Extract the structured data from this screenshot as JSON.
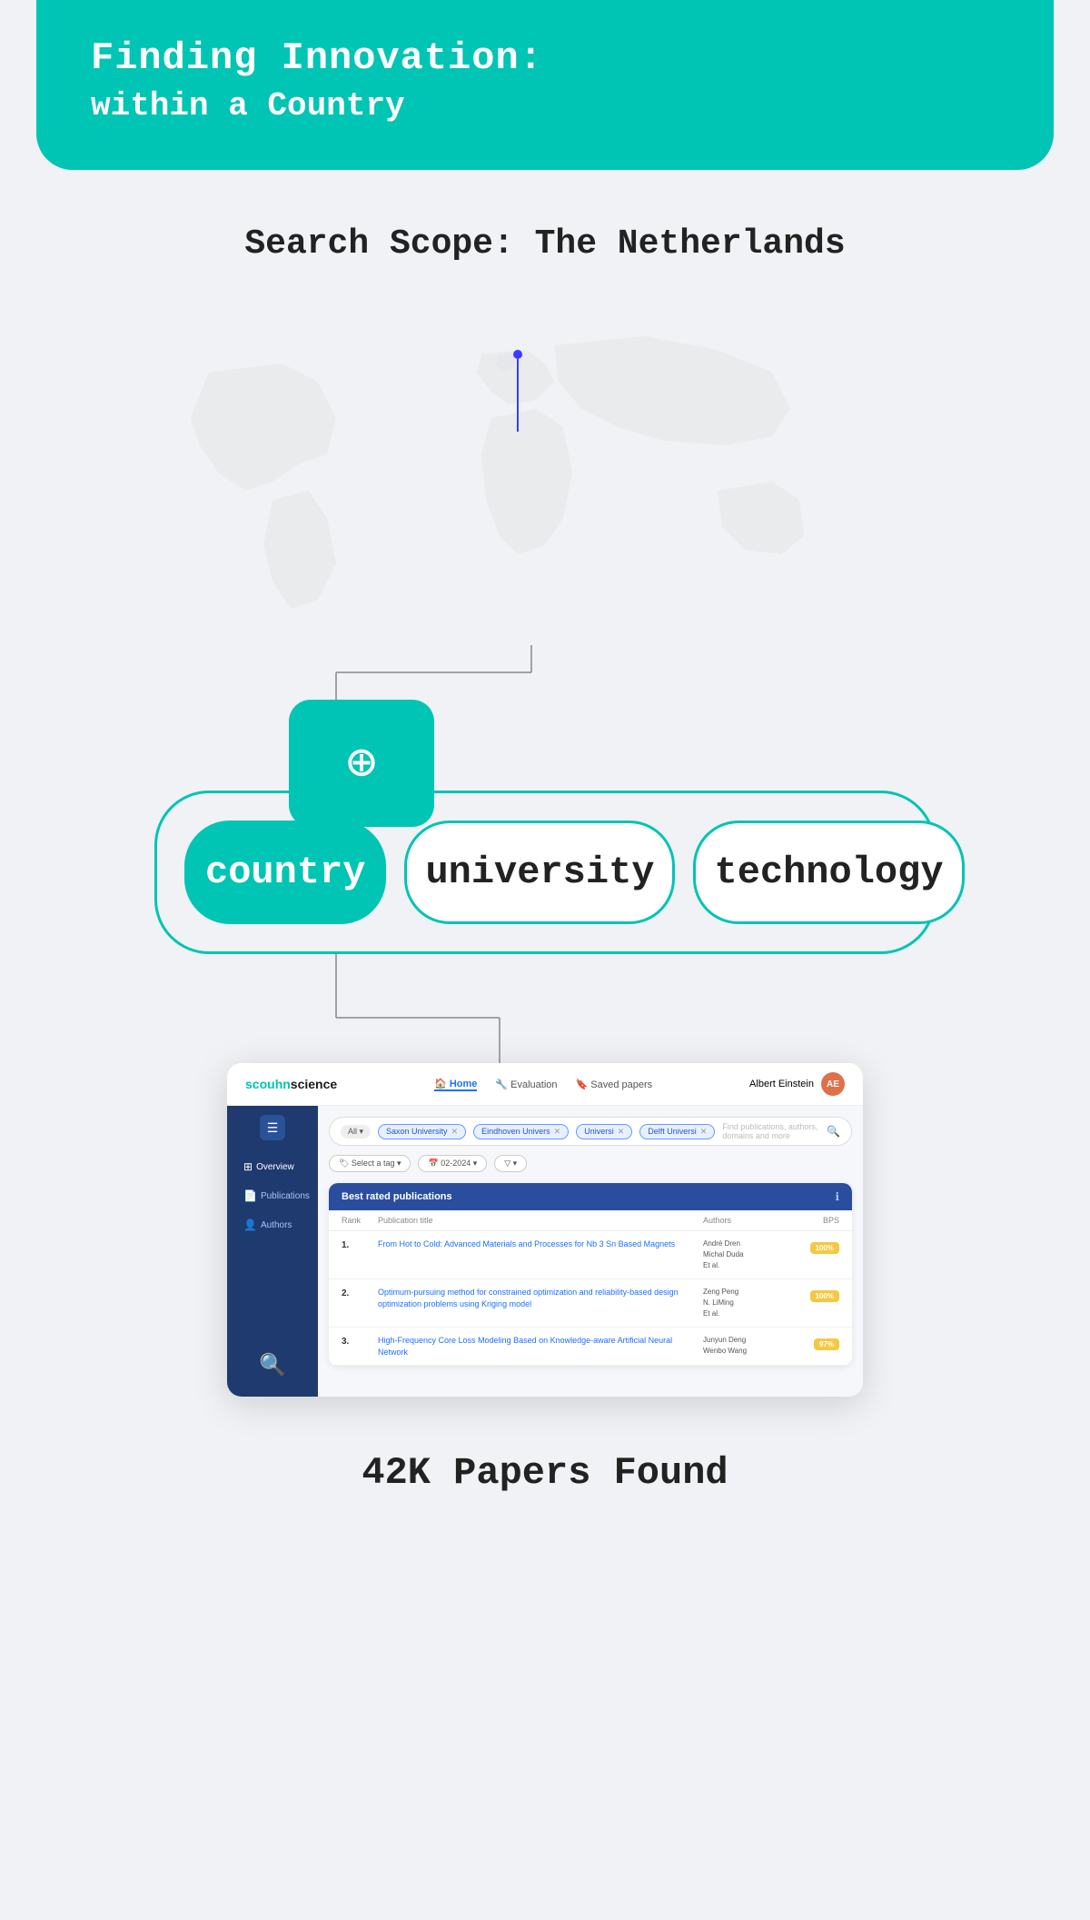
{
  "header": {
    "title": "Finding Innovation:",
    "subtitle": "within a Country"
  },
  "search_scope": {
    "label": "Search Scope: The Netherlands"
  },
  "categories": {
    "items": [
      {
        "label": "country",
        "active": true
      },
      {
        "label": "university",
        "active": false
      },
      {
        "label": "technology",
        "active": false
      }
    ]
  },
  "mockup": {
    "logo": "scou",
    "logo_accent": "hn",
    "logo_end": "science",
    "nav_links": [
      "Home",
      "Evaluation",
      "Saved papers"
    ],
    "user": "Albert Einstein",
    "search_tags": [
      {
        "text": "Saxon University"
      },
      {
        "text": "Eindhoven Univers"
      },
      {
        "text": "Universi"
      },
      {
        "text": "Delft Universi"
      }
    ],
    "search_placeholder": "Find publications, authors, domains and more",
    "filters": [
      "Select a tag",
      "02-2024",
      "▽"
    ],
    "table_title": "Best rated publications",
    "columns": [
      "Rank",
      "Publication title",
      "Authors",
      "BPS"
    ],
    "rows": [
      {
        "rank": "1.",
        "title": "From Hot to Cold: Advanced Materials and Processes for Nb 3 Sn Based Magnets",
        "authors": "André Dren\nMichal Duda\nEt al.",
        "bps": "100%"
      },
      {
        "rank": "2.",
        "title": "Optimum-pursuing method for constrained optimization and reliability-based design optimization problems using Kriging model",
        "authors": "Zeng Peng\nN. LiMing\nEt al.",
        "bps": "100%"
      },
      {
        "rank": "3.",
        "title": "High-Frequency Core Loss Modeling Based on Knowledge-aware Artificial Neural Network",
        "authors": "Junyun Deng\nWenbo Wang",
        "bps": "97%"
      }
    ],
    "sidebar_items": [
      "Overview",
      "Publications",
      "Authors"
    ]
  },
  "papers_found": {
    "label": "42K Papers Found"
  }
}
